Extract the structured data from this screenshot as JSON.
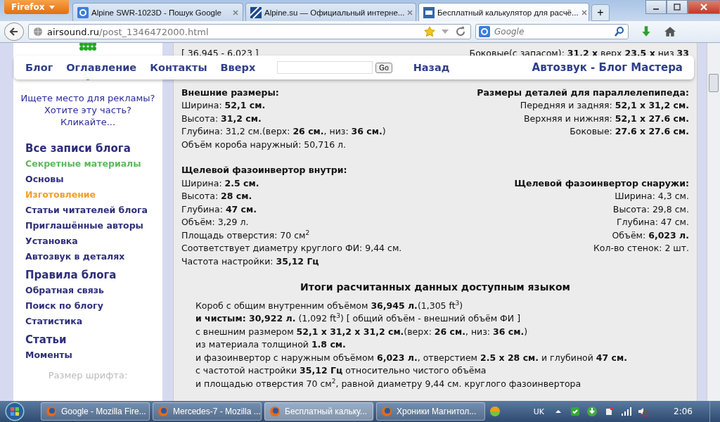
{
  "browser": {
    "menu_button": "Firefox",
    "tabs": [
      {
        "title": "Alpine SWR-1023D - Пошук Google",
        "selected": false
      },
      {
        "title": "Alpine.su — Официальный интерне...",
        "selected": false
      },
      {
        "title": "Бесплатный калькулятор для расчё...",
        "selected": true
      }
    ],
    "new_tab": "+",
    "url_host": "airsound.ru",
    "url_path": "/post_1346472000.html",
    "search_placeholder": "Google"
  },
  "sidebar": {
    "ad_lines": [
      "Ищете место для рекламы?",
      "Хотите эту часть?",
      "Кликайте..."
    ],
    "items": [
      {
        "kind": "section",
        "label": "Все записи блога"
      },
      {
        "kind": "link",
        "label": "Секретные материалы",
        "color": "#5cb85c"
      },
      {
        "kind": "link",
        "label": "Основы",
        "color": "#2e2e7a"
      },
      {
        "kind": "link",
        "label": "Изготовление",
        "color": "#f0a020"
      },
      {
        "kind": "link",
        "label": "Статьи читателей блога",
        "color": "#2e2e7a"
      },
      {
        "kind": "link",
        "label": "Приглашённые авторы",
        "color": "#2e2e7a"
      },
      {
        "kind": "link",
        "label": "Установка",
        "color": "#2e2e7a"
      },
      {
        "kind": "link",
        "label": "Автозвук в деталях",
        "color": "#2e2e7a"
      },
      {
        "kind": "section",
        "label": "Правила блога"
      },
      {
        "kind": "link",
        "label": "Обратная связь",
        "color": "#2e2e7a"
      },
      {
        "kind": "link",
        "label": "Поиск по блогу",
        "color": "#2e2e7a"
      },
      {
        "kind": "link",
        "label": "Статистика",
        "color": "#2e2e7a"
      },
      {
        "kind": "section",
        "label": "Статьи"
      },
      {
        "kind": "link",
        "label": "Моменты",
        "color": "#2e2e7a"
      }
    ],
    "font_size_label": "Размер шрифта:"
  },
  "top_bar": {
    "links": [
      "Блог",
      "Оглавление",
      "Контакты",
      "Вверх"
    ],
    "go_button": "Go",
    "back_link": "Назад",
    "site_title": "Автозвук - Блог Мастера"
  },
  "content": {
    "top_line": {
      "left": "[ 36,945 - 6,023 ]",
      "right": "Боковые(с запасом): **31,2 x** верх **23,5 x** низ **33**"
    },
    "blocks": [
      {
        "rows": [
          {
            "left": {
              "kind": "heading",
              "text": "Внешние размеры:"
            },
            "right": {
              "kind": "heading",
              "text": "Размеры деталей для параллелепипеда:"
            }
          },
          {
            "left": {
              "kind": "line",
              "text": "Ширина: **52,1 см.**"
            },
            "right": {
              "kind": "line",
              "text": "Передняя и задняя: **52,1 x 31,2 см.**"
            }
          },
          {
            "left": {
              "kind": "line",
              "text": "Высота: **31,2 см.**"
            },
            "right": {
              "kind": "line",
              "text": "Верхняя и нижняя: **52,1 x 27.6 см.**"
            }
          },
          {
            "left": {
              "kind": "line",
              "text": "Глубина: 31,2 см.(верх: **26 см.**, низ: **36 см.**)"
            },
            "right": {
              "kind": "line",
              "text": "Боковые: **27.6 x 27.6 см.**"
            }
          },
          {
            "left": {
              "kind": "line",
              "text": "Объём короба наружный: 50,716 л."
            }
          }
        ]
      },
      {
        "rows": [
          {
            "left": {
              "kind": "heading",
              "text": "Щелевой фазоинвертор внутри:"
            }
          },
          {
            "left": {
              "kind": "line",
              "text": "Ширина: **2.5 см.**"
            },
            "right": {
              "kind": "heading",
              "text": "Щелевой фазоинвертор снаружи:"
            }
          },
          {
            "left": {
              "kind": "line",
              "text": "Высота: **28 см.**"
            },
            "right": {
              "kind": "line",
              "text": "Ширина: 4,3 см."
            }
          },
          {
            "left": {
              "kind": "line",
              "text": "Глубина: **47 см.**"
            },
            "right": {
              "kind": "line",
              "text": "Высота: 29,8 см."
            }
          },
          {
            "left": {
              "kind": "line",
              "text": "Объём: 3,29 л."
            },
            "right": {
              "kind": "line",
              "text": "Глубина: 47 см."
            }
          },
          {
            "left": {
              "kind": "line",
              "text": "Площадь отверстия: 70 см$^{2}$"
            },
            "right": {
              "kind": "line",
              "text": "Объём: **6,023 л.**"
            }
          },
          {
            "left": {
              "kind": "line",
              "text": "Соответствует диаметру круглого ФИ: 9,44 см."
            },
            "right": {
              "kind": "line",
              "text": "Кол-во стенок: 2 шт."
            }
          },
          {
            "left": {
              "kind": "line",
              "text": "Частота настройки: **35,12 Гц**"
            }
          }
        ]
      }
    ],
    "summary_title": "Итоги расчитанных данных доступным языком",
    "summary_lines": [
      "Короб с общим внутренним объёмом **36,945 л.**(1,305 ft$^{3}$)",
      "**и чистым: 30,922 л.** (1,092 ft$^{3}$) [ общий объём - внешний объём ФИ ]",
      "с внешним размером **52,1 x 31,2 x 31,2 см.**(верх: **26 см.**, низ: **36 см.**)",
      "из материала толщиной **1.8 см.**",
      "и фазоинвертор с наружным объёмом **6,023 л.**, отверстием **2.5 x 28 см.** и глубиной **47 см.**",
      "с частотой настройки **35,12 Гц** относительно чистого объёма",
      "и площадью отверстия 70 см$^{2}$, равной диаметру 9,44 см. круглого фазоинвертора"
    ]
  },
  "taskbar": {
    "tasks": [
      {
        "title": "Google - Mozilla Fire...",
        "selected": false
      },
      {
        "title": "Mercedes-7 - Mozilla ...",
        "selected": false
      },
      {
        "title": "Бесплатный кальку...",
        "selected": true
      },
      {
        "title": "Хроники Магнитол...",
        "selected": false
      }
    ],
    "language": "UK",
    "time": "2:06"
  }
}
